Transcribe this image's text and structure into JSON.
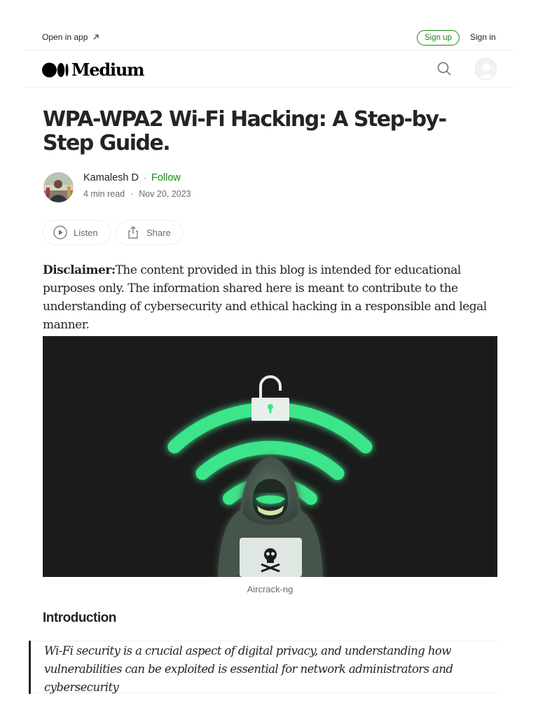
{
  "topbar": {
    "open_in_app": "Open in app",
    "sign_up": "Sign up",
    "sign_in": "Sign in"
  },
  "header": {
    "logo_text": "Medium",
    "icons": [
      "medium-logo-icon",
      "search-icon",
      "user-avatar-icon"
    ]
  },
  "article": {
    "title": "WPA-WPA2 Wi-Fi Hacking: A Step-by-Step Guide.",
    "author": {
      "name": "Kamalesh D",
      "follow_label": "Follow",
      "read_time": "4 min read",
      "date": "Nov 20, 2023"
    },
    "actions": {
      "listen_label": "Listen",
      "share_label": "Share"
    },
    "disclaimer_label": "Disclaimer:",
    "disclaimer_text": "The content provided in this blog is intended for educational purposes only. The information shared here is meant to contribute to the understanding of cybersecurity and ethical hacking in a responsible and legal manner.",
    "image_caption": "Aircrack-ng",
    "section_heading": "Introduction",
    "quote_text": "Wi-Fi security is a crucial aspect of digital privacy, and understanding how vulnerabilities can be exploited is essential for network administrators and cybersecurity"
  },
  "colors": {
    "accent_green": "#1a8917",
    "text_primary": "#242424",
    "text_secondary": "#6b6b6b",
    "hero_background": "#1b1b1b",
    "hero_glow": "#3ee58a"
  }
}
